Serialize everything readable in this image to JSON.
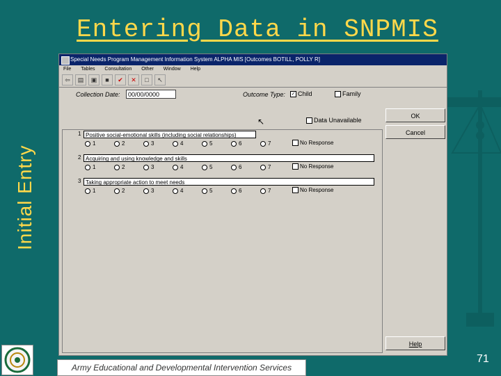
{
  "slide": {
    "title": "Entering Data in SNPMIS",
    "side_title": "Initial Entry",
    "footer_text": "Army Educational and Developmental Intervention Services",
    "page_number": "71"
  },
  "window": {
    "title": "Special Needs Program Management Information System    ALPHA MIS    [Outcomes    BOTILL, POLLY R]",
    "menu": [
      "File",
      "Tables",
      "Consultation",
      "Other",
      "Window",
      "Help"
    ],
    "toolbar_icons": [
      "exit-icon",
      "print-icon",
      "lock-icon",
      "save-icon",
      "check-icon",
      "delete-icon",
      "new-icon",
      "cursor-icon"
    ]
  },
  "form": {
    "collection_date_label": "Collection Date:",
    "collection_date_value": "00/00/0000",
    "outcome_type_label": "Outcome Type:",
    "child_label": "Child",
    "child_checked": true,
    "family_label": "Family",
    "family_checked": false,
    "data_unavailable_label": "Data Unavailable",
    "buttons": {
      "ok": "OK",
      "cancel": "Cancel",
      "help": "Help"
    },
    "questions": [
      {
        "number": "1",
        "text": "Positive social-emotional skills (including social relationships)"
      },
      {
        "number": "2",
        "text": "Acquiring and using knowledge and skills"
      },
      {
        "number": "3",
        "text": "Taking appropriate action to meet needs"
      }
    ],
    "rating_options": [
      "1",
      "2",
      "3",
      "4",
      "5",
      "6",
      "7"
    ],
    "no_response_label": "No Response"
  }
}
